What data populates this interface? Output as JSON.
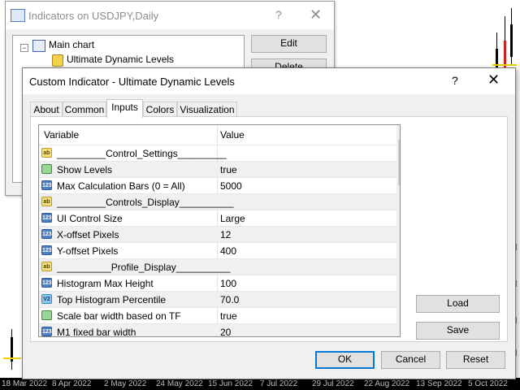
{
  "chart": {
    "axis_labels": [
      "18 Mar 2022",
      "8 Apr 2022",
      "2 May 2022",
      "24 May 2022",
      "15 Jun 2022",
      "7 Jul 2022",
      "29 Jul 2022",
      "22 Aug 2022",
      "13 Sep 2022",
      "5 Oct 2022"
    ]
  },
  "back_dialog": {
    "title": "Indicators on USDJPY,Daily",
    "help": "?",
    "close": "✕",
    "tree": {
      "root_label": "Main chart",
      "child_label": "Ultimate Dynamic Levels"
    },
    "edit_button": "Edit",
    "delete_button": "Delete"
  },
  "dialog": {
    "title": "Custom Indicator - Ultimate Dynamic Levels",
    "help": "?",
    "close": "✕",
    "tabs": [
      "About",
      "Common",
      "Inputs",
      "Colors",
      "Visualization"
    ],
    "active_tab": "Inputs",
    "grid": {
      "headers": {
        "variable": "Variable",
        "value": "Value"
      },
      "rows": [
        {
          "type": "ab",
          "icon": "ab",
          "variable": "_________Control_Settings_________",
          "value": ""
        },
        {
          "type": "bool",
          "icon": "",
          "variable": "Show Levels",
          "value": "true"
        },
        {
          "type": "int",
          "icon": "123",
          "variable": "Max Calculation Bars (0 = All)",
          "value": "5000"
        },
        {
          "type": "ab",
          "icon": "ab",
          "variable": "_________Controls_Display__________",
          "value": ""
        },
        {
          "type": "int",
          "icon": "123",
          "variable": "UI Control Size",
          "value": "Large"
        },
        {
          "type": "int",
          "icon": "123",
          "variable": "X-offset Pixels",
          "value": "12"
        },
        {
          "type": "int",
          "icon": "123",
          "variable": "Y-offset Pixels",
          "value": "400"
        },
        {
          "type": "ab",
          "icon": "ab",
          "variable": "__________Profile_Display__________",
          "value": ""
        },
        {
          "type": "int",
          "icon": "123",
          "variable": "Histogram Max Height",
          "value": "100"
        },
        {
          "type": "dbl",
          "icon": "V2",
          "variable": "Top Histogram Percentile",
          "value": "70.0"
        },
        {
          "type": "bool",
          "icon": "",
          "variable": "Scale bar width based on TF",
          "value": "true"
        },
        {
          "type": "int",
          "icon": "123",
          "variable": "M1 fixed bar width",
          "value": "20"
        }
      ]
    },
    "load_button": "Load",
    "save_button": "Save",
    "ok_button": "OK",
    "cancel_button": "Cancel",
    "reset_button": "Reset"
  }
}
